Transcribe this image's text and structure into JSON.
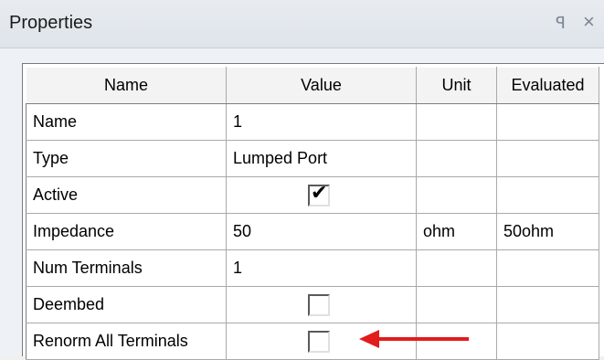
{
  "panel": {
    "title": "Properties",
    "pin_glyph": "ꟼ",
    "close_glyph": "×"
  },
  "table": {
    "headers": [
      "Name",
      "Value",
      "Unit",
      "Evaluated"
    ],
    "rows": [
      {
        "name": "Name",
        "value": "1",
        "unit": "",
        "evaluated": ""
      },
      {
        "name": "Type",
        "value": "Lumped Port",
        "unit": "",
        "evaluated": ""
      },
      {
        "name": "Active",
        "value": "",
        "checkbox": true,
        "checked": true,
        "unit": "",
        "evaluated": ""
      },
      {
        "name": "Impedance",
        "value": "50",
        "unit": "ohm",
        "evaluated": "50ohm"
      },
      {
        "name": "Num Terminals",
        "value": "1",
        "unit": "",
        "evaluated": ""
      },
      {
        "name": "Deembed",
        "value": "",
        "checkbox": true,
        "checked": false,
        "unit": "",
        "evaluated": ""
      },
      {
        "name": "Renorm All Terminals",
        "value": "",
        "checkbox": true,
        "checked": false,
        "unit": "",
        "evaluated": ""
      }
    ]
  },
  "colors": {
    "annotation_arrow": "#e31b1b"
  }
}
